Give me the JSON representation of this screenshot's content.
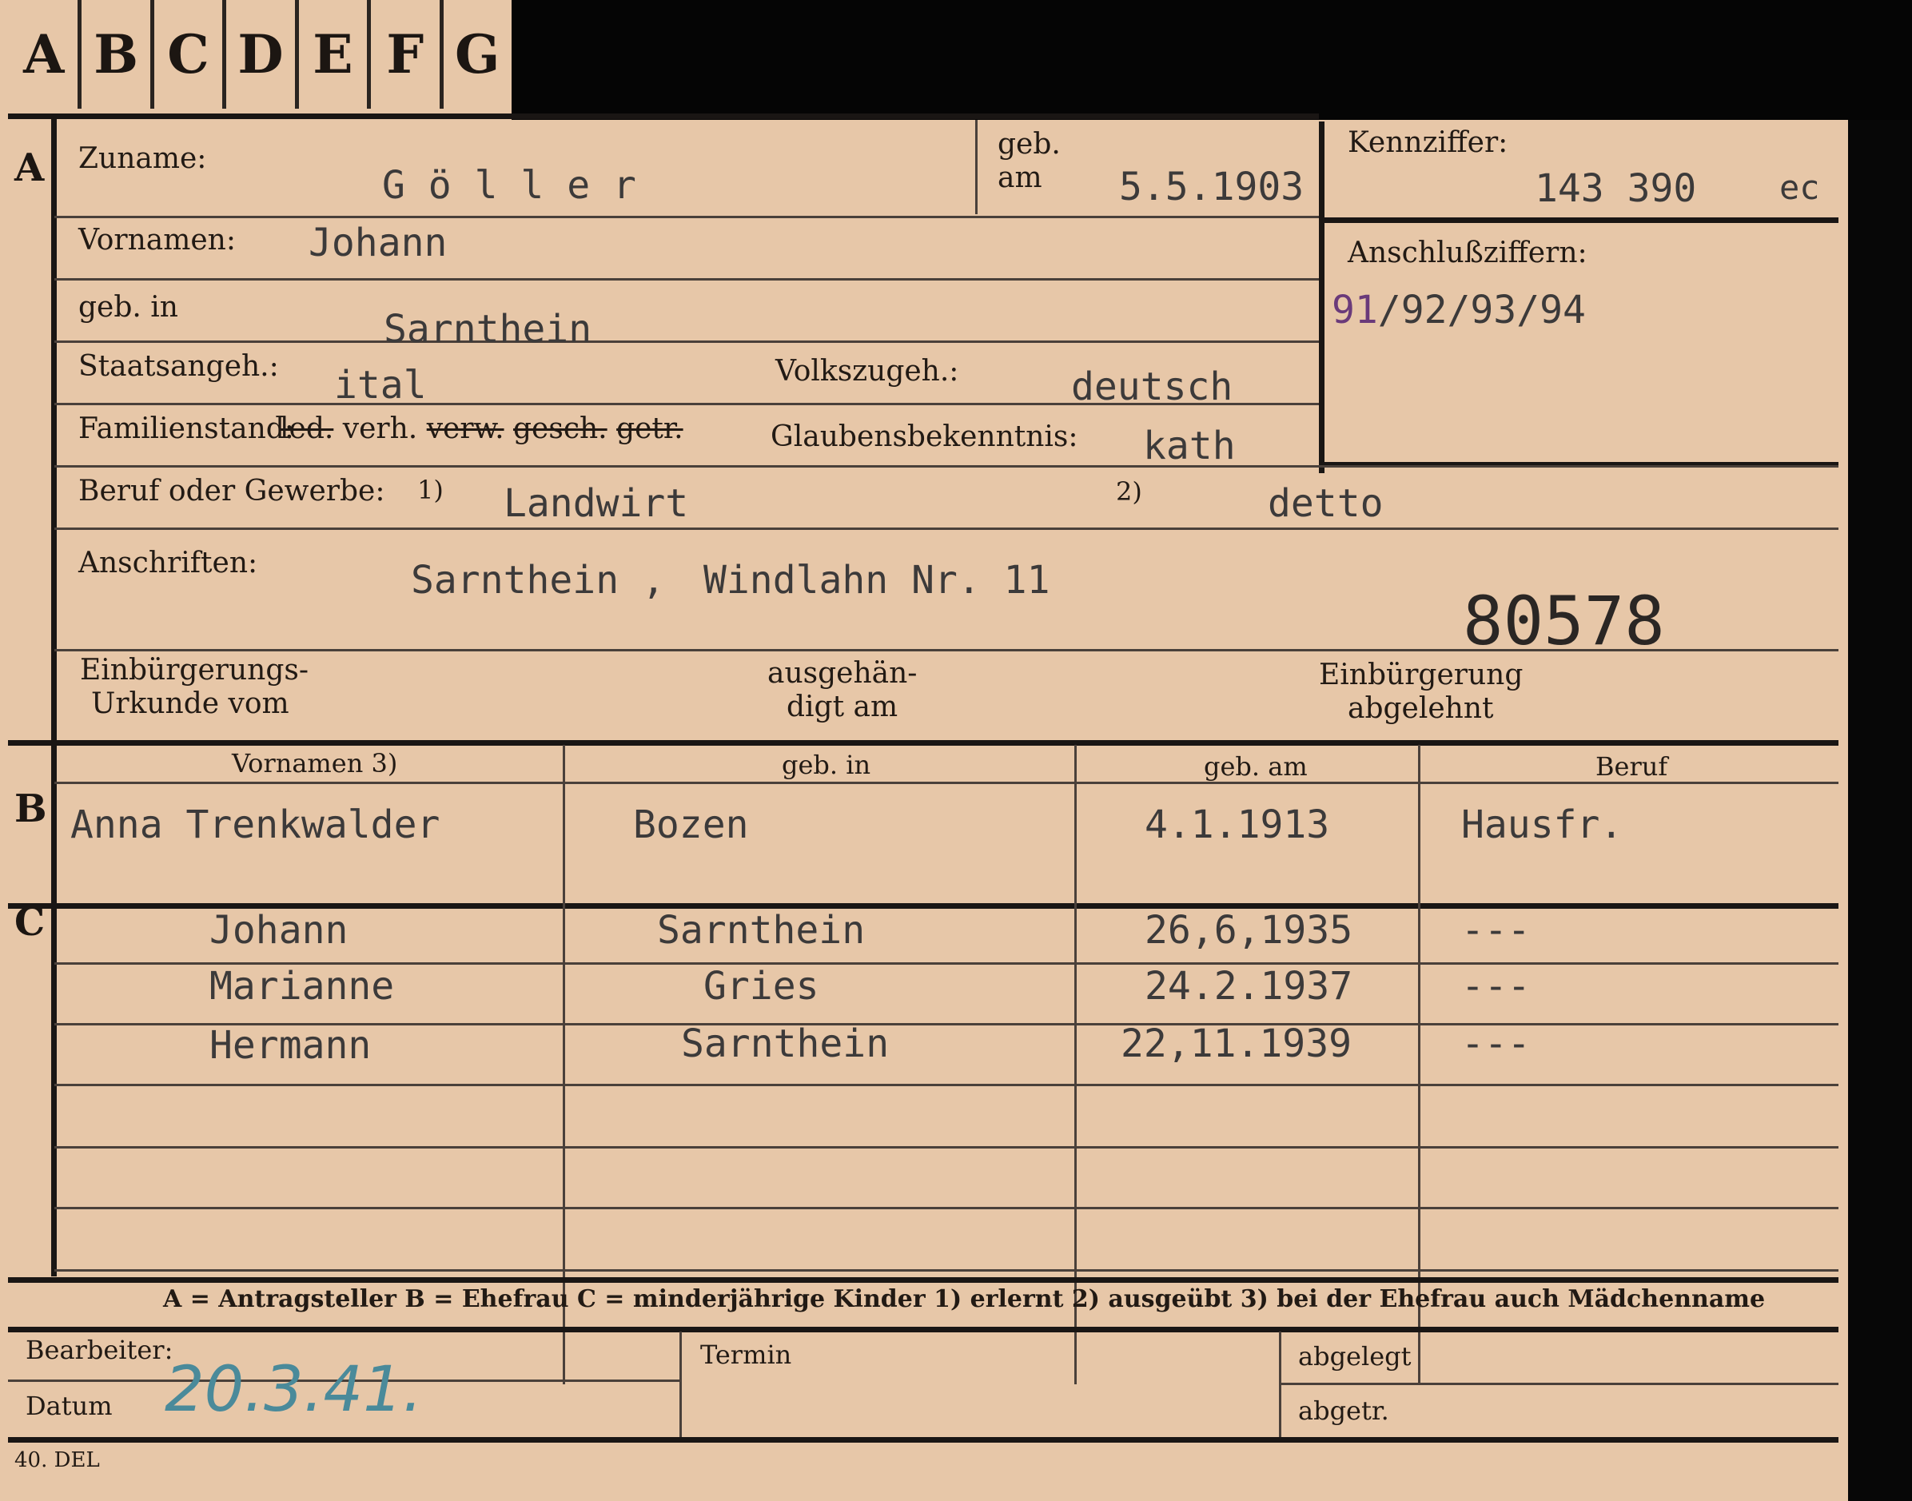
{
  "tabs": [
    "A",
    "B",
    "C",
    "D",
    "E",
    "F",
    "G"
  ],
  "section_markers": {
    "a": "A",
    "b": "B",
    "c": "C"
  },
  "applicant": {
    "surname_label": "Zuname:",
    "surname": "G ö l l e r",
    "born_on_label_1": "geb.",
    "born_on_label_2": "am",
    "born_on": "5.5.1903",
    "given_names_label": "Vornamen:",
    "given_names": "Johann",
    "birthplace_label": "geb. in",
    "birthplace": "Sarnthein",
    "citizenship_label": "Staatsangeh.:",
    "citizenship": "ital",
    "ethnicity_label": "Volkszugeh.:",
    "ethnicity": "deutsch",
    "marital_label": "Familienstand:",
    "marital_options": [
      "led.",
      "verh.",
      "verw.",
      "gesch.",
      "getr."
    ],
    "religion_label": "Glaubensbekenntnis:",
    "religion": "kath",
    "occupation_label": "Beruf oder Gewerbe:",
    "occupation_marker_1": "1)",
    "occupation_1": "Landwirt",
    "occupation_marker_2": "2)",
    "occupation_2": "detto",
    "address_label": "Anschriften:",
    "address_place": "Sarnthein ,",
    "address_street": "Windlahn Nr. 11",
    "stamp_number": "80578",
    "naturalization_label_1": "Einbürgerungs-",
    "naturalization_label_2": "Urkunde vom",
    "handed_label_1": "ausgehän-",
    "handed_label_2": "digt am",
    "rejected_label_1": "Einbürgerung",
    "rejected_label_2": "abgelehnt"
  },
  "reference": {
    "kennziffer_label": "Kennziffer:",
    "kennziffer": "143 390",
    "kennziffer_suffix": "ec",
    "anschluss_label": "Anschlußziffern:",
    "anschluss_first": "91",
    "anschluss_rest": "/92/93/94"
  },
  "table_headers": [
    "Vornamen 3)",
    "geb. in",
    "geb. am",
    "Beruf"
  ],
  "spouse": {
    "name": "Anna Trenkwalder",
    "birthplace": "Bozen",
    "born_on": "4.1.1913",
    "occupation": "Hausfr."
  },
  "children": [
    {
      "name": "Johann",
      "birthplace": "Sarnthein",
      "born_on": "26,6,1935",
      "occupation": "---"
    },
    {
      "name": "Marianne",
      "birthplace": "Gries",
      "born_on": "24.2.1937",
      "occupation": "---"
    },
    {
      "name": "Hermann",
      "birthplace": "Sarnthein",
      "born_on": "22,11.1939",
      "occupation": "---"
    }
  ],
  "legend": "A = Antragsteller  B = Ehefrau  C = minderjährige Kinder  1) erlernt  2) ausgeübt  3) bei der Ehefrau auch Mädchenname",
  "footer": {
    "clerk_label": "Bearbeiter:",
    "date_label": "Datum",
    "date_value": "20.3.41.",
    "deadline_label": "Termin",
    "filed_label": "abgelegt",
    "written_label": "abgetr.",
    "form_code": "40. DEL"
  },
  "colors": {
    "paper": "#e7c7a8",
    "ink": "#1c1612",
    "pen_blue": "#4a8a9a",
    "violet": "#6a3a7a"
  }
}
